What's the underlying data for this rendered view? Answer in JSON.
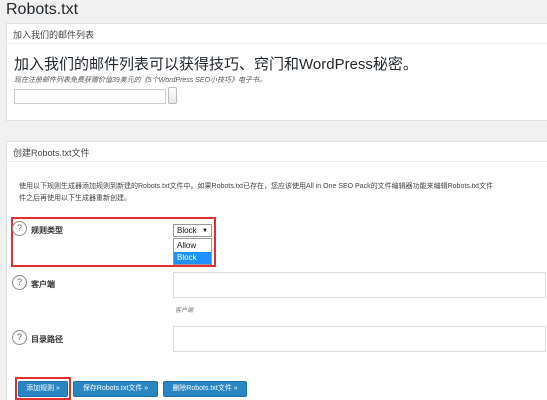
{
  "page": {
    "title": "Robots.txt"
  },
  "signup": {
    "section_title": "加入我们的邮件列表",
    "heading": "加入我们的邮件列表可以获得技巧、窍门和WordPress秘密。",
    "description": "现在注册邮件列表免费获赠价值39美元的《5个WordPress SEO小技巧》电子书。",
    "email_value": "",
    "subscribe_label": ""
  },
  "robots": {
    "section_title": "创建Robots.txt文件",
    "intro_line1": "使用以下规则生成器添加规则到新建的Robots.txt文件中。如果Robots.txt已存在，您应该使用All in One SEO Pack的文件编辑器功能来编辑Robots.txt文件",
    "intro_line2": "件之后再使用以下生成器重新创建。",
    "rule_type_label": "规则类型",
    "rule_type_selected": "Block",
    "rule_type_options": [
      "Allow",
      "Block"
    ],
    "user_agent_label": "客户端",
    "user_agent_value": "",
    "user_agent_hint": "客户端",
    "path_label": "目录路径",
    "path_value": "",
    "help_glyph": "?",
    "dropdown_arrow": "▼"
  },
  "buttons": {
    "add_rule": "添加规则 »",
    "save_robots": "保存Robots.txt文件 »",
    "delete_robots": "删除Robots.txt文件 »"
  },
  "colors": {
    "accent": "#2a86c2",
    "highlight": "#e0312f",
    "selected_option": "#1e90ff",
    "background": "#f1f1f1"
  }
}
